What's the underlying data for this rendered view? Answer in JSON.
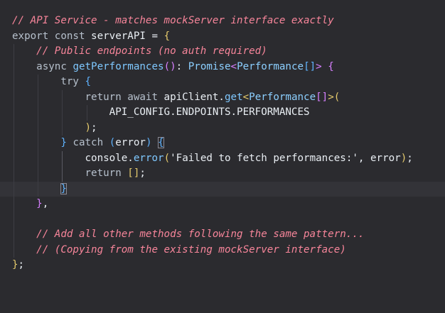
{
  "editor": {
    "lines": [
      {
        "segments": [
          {
            "cls": "c",
            "text": "// API Service - matches mockServer interface exactly"
          }
        ]
      },
      {
        "segments": [
          {
            "cls": "k",
            "text": "export"
          },
          {
            "cls": "id",
            "text": " "
          },
          {
            "cls": "k",
            "text": "const"
          },
          {
            "cls": "id",
            "text": " serverAPI = "
          },
          {
            "cls": "p",
            "text": "{"
          }
        ]
      },
      {
        "segments": [
          {
            "cls": "id",
            "text": "    "
          },
          {
            "cls": "c",
            "text": "// Public endpoints (no auth required)"
          }
        ]
      },
      {
        "segments": [
          {
            "cls": "id",
            "text": "    "
          },
          {
            "cls": "k",
            "text": "async"
          },
          {
            "cls": "id",
            "text": " "
          },
          {
            "cls": "fn",
            "text": "getPerformances"
          },
          {
            "cls": "b",
            "text": "()"
          },
          {
            "cls": "id",
            "text": ": "
          },
          {
            "cls": "ty",
            "text": "Promise"
          },
          {
            "cls": "b",
            "text": "<"
          },
          {
            "cls": "ty",
            "text": "Performance"
          },
          {
            "cls": "b2",
            "text": "[]"
          },
          {
            "cls": "b",
            "text": ">"
          },
          {
            "cls": "id",
            "text": " "
          },
          {
            "cls": "b",
            "text": "{"
          }
        ]
      },
      {
        "segments": [
          {
            "cls": "id",
            "text": "        "
          },
          {
            "cls": "k",
            "text": "try"
          },
          {
            "cls": "id",
            "text": " "
          },
          {
            "cls": "b2",
            "text": "{"
          }
        ]
      },
      {
        "segments": [
          {
            "cls": "id",
            "text": "            "
          },
          {
            "cls": "k",
            "text": "return"
          },
          {
            "cls": "id",
            "text": " "
          },
          {
            "cls": "k",
            "text": "await"
          },
          {
            "cls": "id",
            "text": " apiClient."
          },
          {
            "cls": "fn",
            "text": "get"
          },
          {
            "cls": "p",
            "text": "<"
          },
          {
            "cls": "ty",
            "text": "Performance"
          },
          {
            "cls": "b",
            "text": "[]"
          },
          {
            "cls": "p",
            "text": ">("
          }
        ]
      },
      {
        "segments": [
          {
            "cls": "id",
            "text": "                API_CONFIG."
          },
          {
            "cls": "const",
            "text": "ENDPOINTS"
          },
          {
            "cls": "id",
            "text": "."
          },
          {
            "cls": "const",
            "text": "PERFORMANCES"
          }
        ]
      },
      {
        "segments": [
          {
            "cls": "id",
            "text": "            "
          },
          {
            "cls": "p",
            "text": ")"
          },
          {
            "cls": "id",
            "text": ";"
          }
        ]
      },
      {
        "segments": [
          {
            "cls": "id",
            "text": "        "
          },
          {
            "cls": "b2",
            "text": "}"
          },
          {
            "cls": "id",
            "text": " "
          },
          {
            "cls": "k",
            "text": "catch"
          },
          {
            "cls": "id",
            "text": " "
          },
          {
            "cls": "b2",
            "text": "("
          },
          {
            "cls": "id",
            "text": "error"
          },
          {
            "cls": "b2",
            "text": ")"
          },
          {
            "cls": "id",
            "text": " "
          },
          {
            "cls": "b2 hlb",
            "text": "{"
          }
        ]
      },
      {
        "segments": [
          {
            "cls": "id",
            "text": "            console."
          },
          {
            "cls": "fn",
            "text": "error"
          },
          {
            "cls": "p",
            "text": "("
          },
          {
            "cls": "s",
            "text": "'Failed to fetch performances:'"
          },
          {
            "cls": "id",
            "text": ", error"
          },
          {
            "cls": "p",
            "text": ")"
          },
          {
            "cls": "id",
            "text": ";"
          }
        ]
      },
      {
        "segments": [
          {
            "cls": "id",
            "text": "            "
          },
          {
            "cls": "k",
            "text": "return"
          },
          {
            "cls": "id",
            "text": " "
          },
          {
            "cls": "p",
            "text": "[]"
          },
          {
            "cls": "id",
            "text": ";"
          }
        ]
      },
      {
        "segments": [
          {
            "cls": "id",
            "text": "        "
          },
          {
            "cls": "b2 hlb",
            "text": "}"
          }
        ],
        "active": true
      },
      {
        "segments": [
          {
            "cls": "id",
            "text": "    "
          },
          {
            "cls": "b",
            "text": "}"
          },
          {
            "cls": "id",
            "text": ","
          }
        ]
      },
      {
        "segments": []
      },
      {
        "segments": [
          {
            "cls": "id",
            "text": "    "
          },
          {
            "cls": "c",
            "text": "// Add all other methods following the same pattern..."
          }
        ]
      },
      {
        "segments": [
          {
            "cls": "id",
            "text": "    "
          },
          {
            "cls": "c",
            "text": "// (Copying from the existing mockServer interface)"
          }
        ]
      },
      {
        "segments": [
          {
            "cls": "p",
            "text": "}"
          },
          {
            "cls": "id",
            "text": ";"
          }
        ]
      }
    ]
  }
}
